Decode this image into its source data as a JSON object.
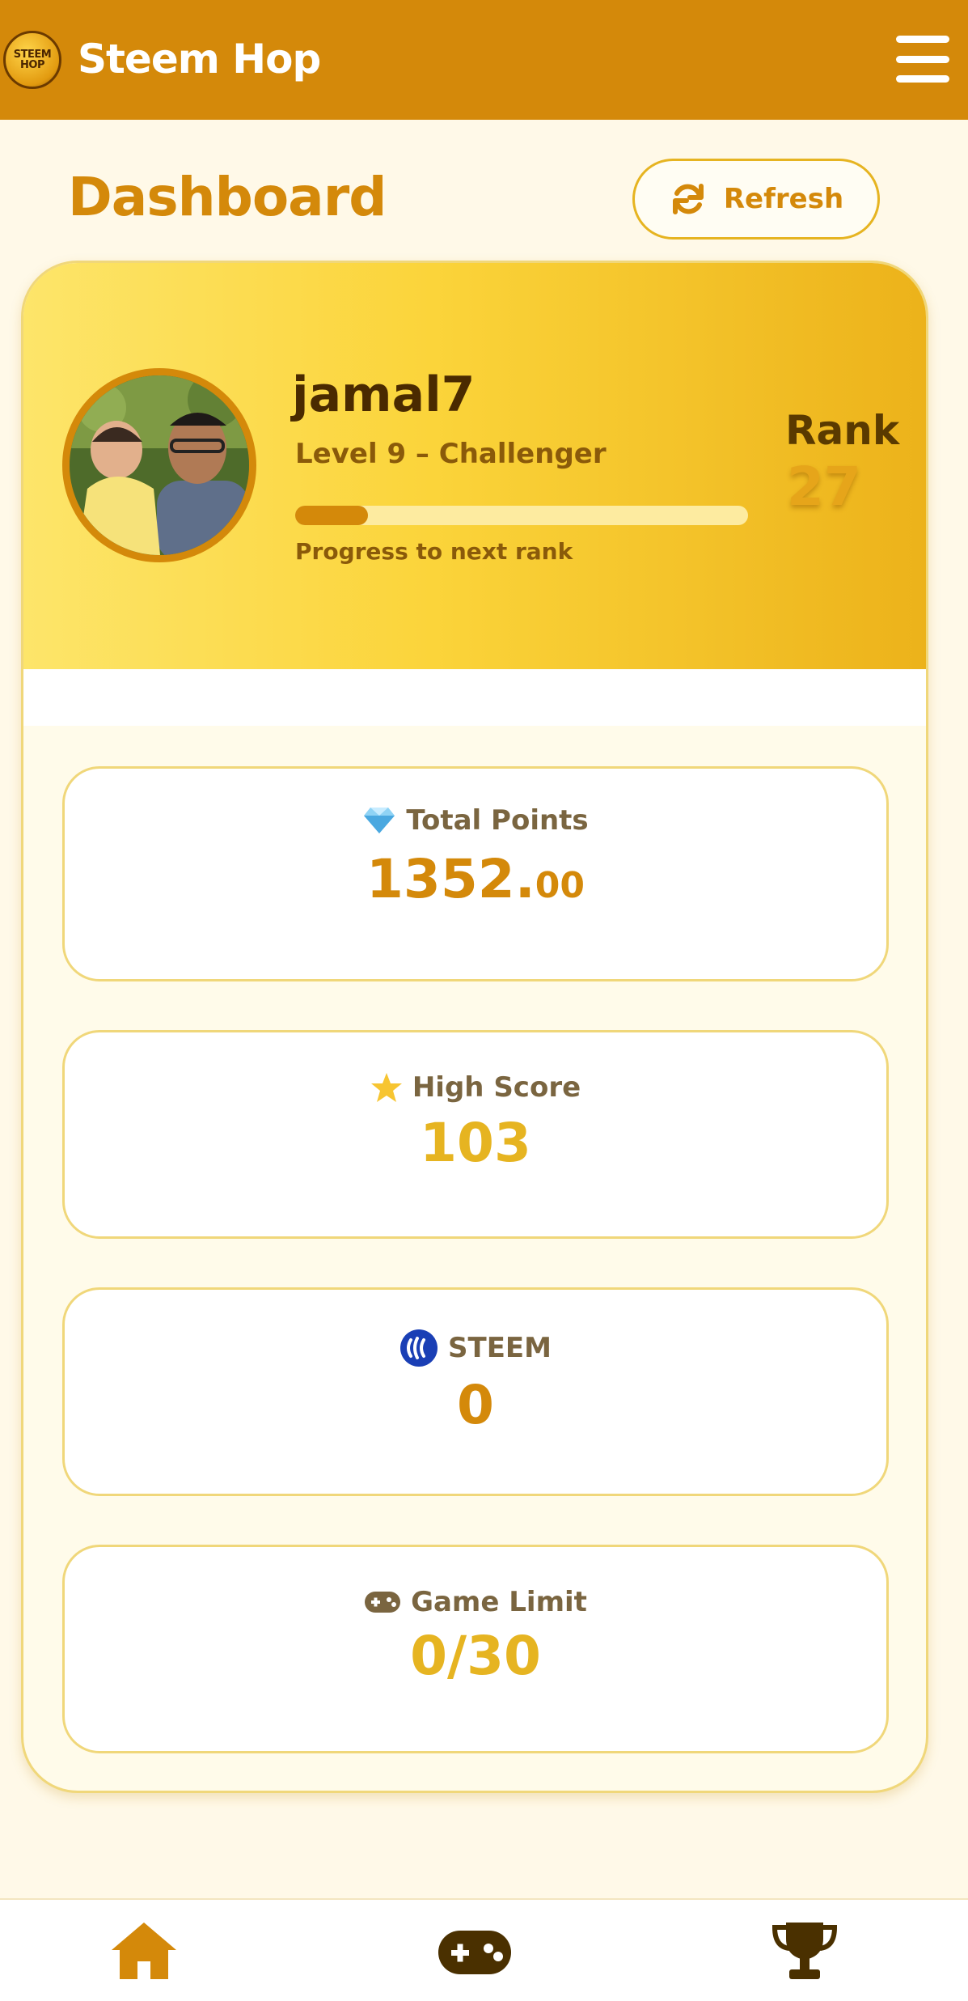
{
  "header": {
    "logo_line1": "STEEM",
    "logo_line2": "HOP",
    "app_title": "Steem Hop"
  },
  "page": {
    "title": "Dashboard",
    "refresh_label": "Refresh"
  },
  "profile": {
    "username": "jamal7",
    "level": "Level 9 – Challenger",
    "progress_label": "Progress to next rank",
    "progress": 0.16,
    "rank_label": "Rank",
    "rank_value": "27"
  },
  "stats": {
    "total_points": {
      "label": "Total Points",
      "int": "1352.",
      "dec": "00",
      "icon": "gem-icon"
    },
    "high_score": {
      "label": "High Score",
      "value": "103",
      "icon": "star-icon"
    },
    "steem": {
      "label": "STEEM",
      "value": "0",
      "icon": "steem-icon"
    },
    "game_limit": {
      "label": "Game Limit",
      "value": "0/30",
      "icon": "gamepad-icon"
    }
  },
  "nav": [
    "home-icon",
    "gamepad-icon",
    "trophy-icon"
  ],
  "colors": {
    "accent": "#d4890a",
    "gold": "#e6b421",
    "background": "#fff9e8",
    "steem_blue": "#1a3fb5"
  }
}
